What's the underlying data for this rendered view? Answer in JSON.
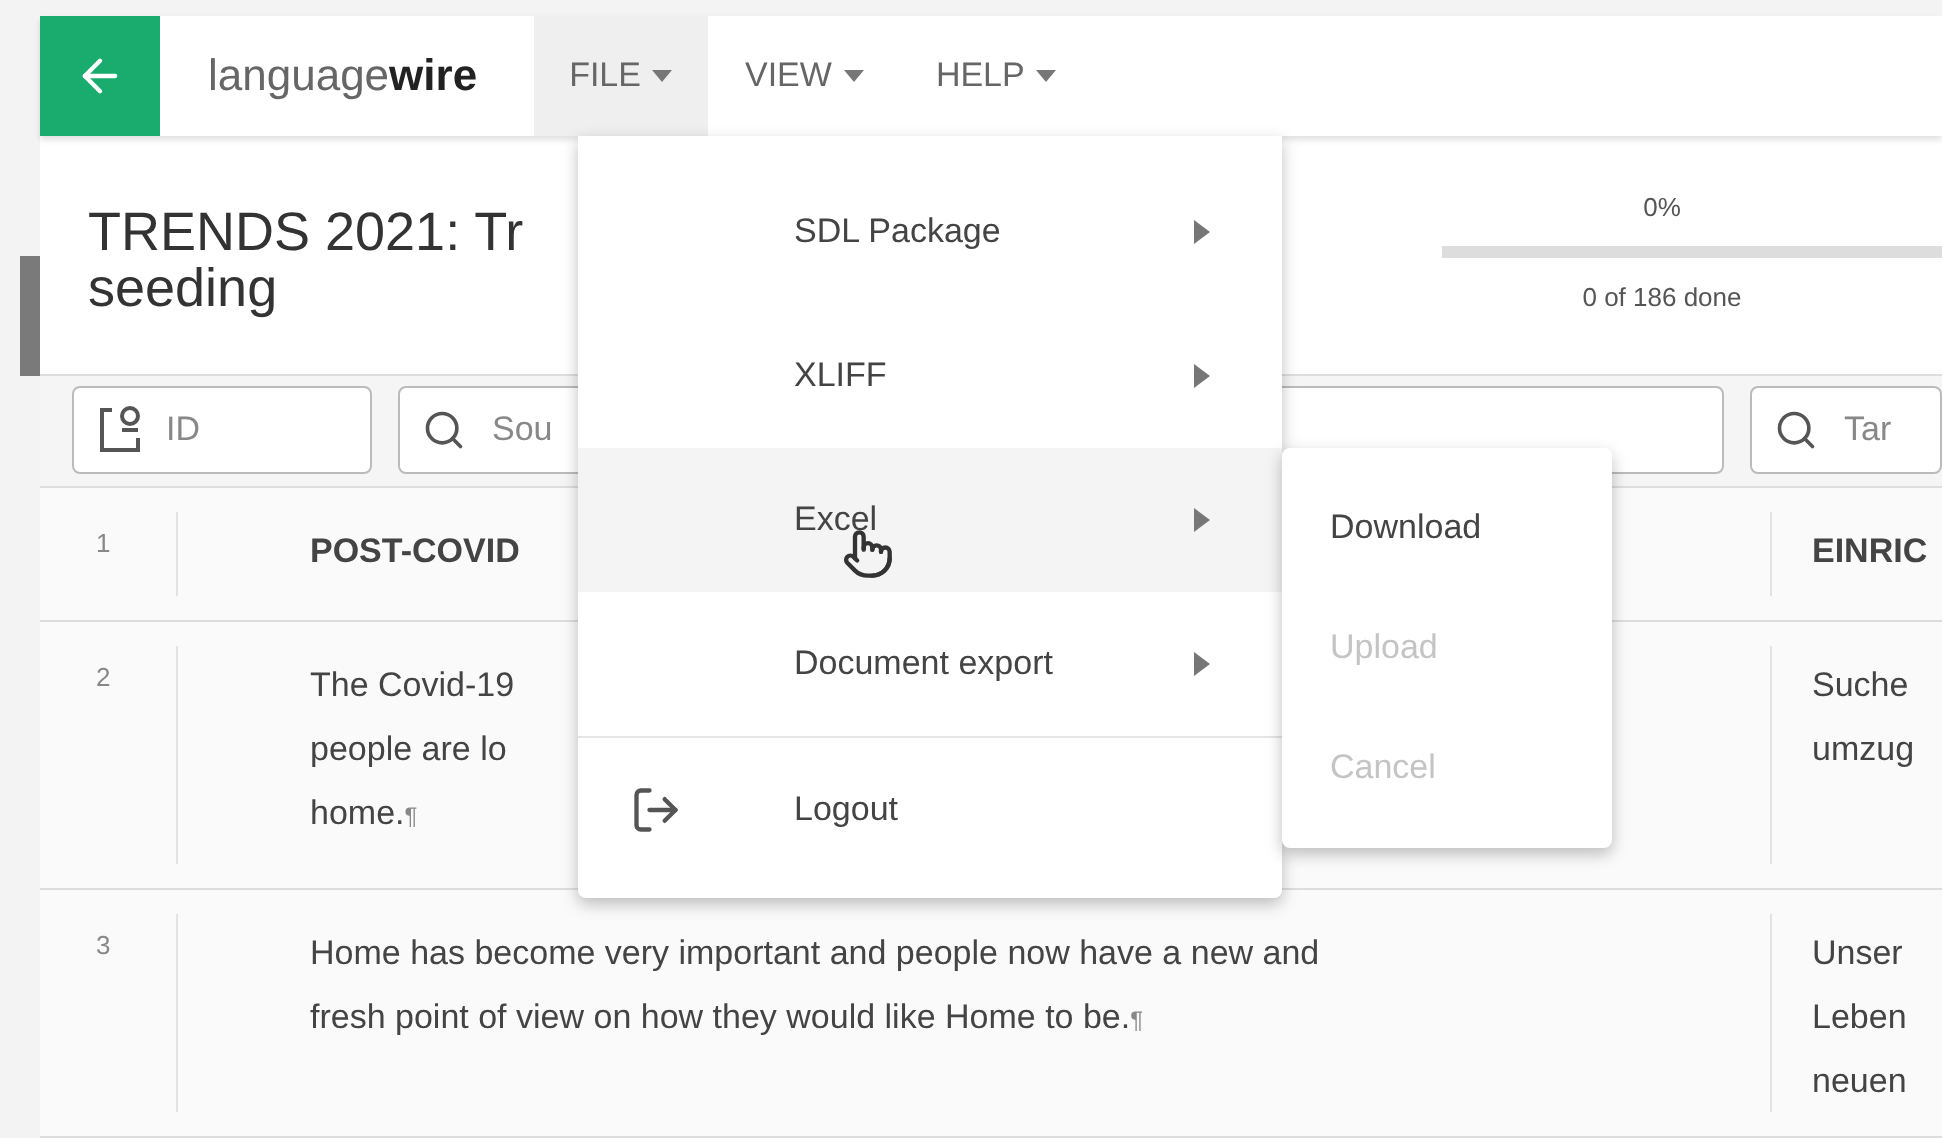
{
  "topbar": {
    "logo": "language**wire**",
    "menus": [
      {
        "label": "FILE",
        "selected": true
      },
      {
        "label": "VIEW",
        "selected": false
      },
      {
        "label": "HELP",
        "selected": false
      }
    ]
  },
  "header": {
    "title_lines": [
      "TRENDS 2021: Tr",
      "seeding"
    ],
    "progress": {
      "percent": "0%",
      "level": 0,
      "done": "0 of 186 done"
    }
  },
  "filters": [
    {
      "kind": "id",
      "placeholder": "ID"
    },
    {
      "kind": "search",
      "placeholder": "Sou"
    },
    {
      "kind": "search",
      "placeholder": "Tar"
    }
  ],
  "rows": [
    {
      "number": "1",
      "header": true,
      "source": [
        "POST-COVID"
      ],
      "source_mark": "",
      "target": [
        "EINRIC"
      ]
    },
    {
      "number": "2",
      "header": false,
      "source": [
        "The Covid-19",
        "people are lo",
        "home."
      ],
      "source_mark": "¶",
      "target": [
        "Suche",
        "umzug"
      ]
    },
    {
      "number": "3",
      "header": false,
      "source": [
        "Home has become very important and people now have a new and",
        "fresh point of view on how they would like Home to be."
      ],
      "source_mark": "¶",
      "target": [
        "Unser",
        "Leben",
        "neuen"
      ]
    }
  ],
  "file_menu": {
    "items": [
      {
        "kind": "submenu",
        "label": "SDL Package",
        "highlighted": false
      },
      {
        "kind": "submenu",
        "label": "XLIFF",
        "highlighted": false
      },
      {
        "kind": "submenu",
        "label": "Excel",
        "highlighted": true
      },
      {
        "kind": "submenu",
        "label": "Document export",
        "highlighted": false
      },
      {
        "kind": "action",
        "label": "Logout",
        "highlighted": false
      }
    ],
    "submenu": [
      {
        "label": "Download",
        "disabled": false
      },
      {
        "label": "Upload",
        "disabled": true
      },
      {
        "label": "Cancel",
        "disabled": true
      }
    ]
  }
}
